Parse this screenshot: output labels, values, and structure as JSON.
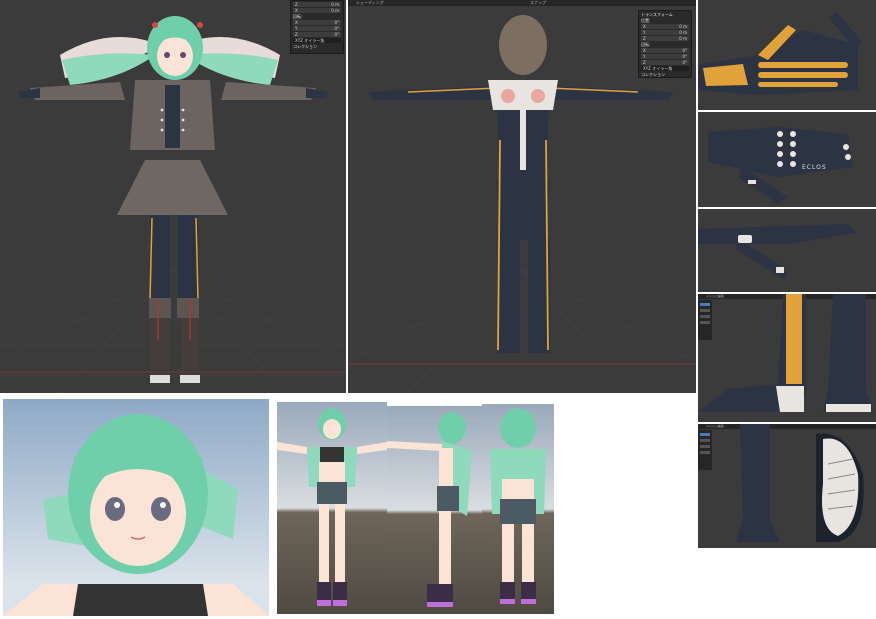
{
  "panels": {
    "front_view": {
      "npanel": {
        "rows_top": [
          {
            "label": "Z",
            "value": "0 m"
          },
          {
            "label": "X",
            "value": "0 m"
          }
        ],
        "section_label": "回転:",
        "rows_mid": [
          {
            "label": "X",
            "value": "0°"
          },
          {
            "label": "Y",
            "value": "0°"
          },
          {
            "label": "Z",
            "value": "0°"
          }
        ],
        "mode": "XYZ オイラー角",
        "collection": "コレクション"
      }
    },
    "back_view": {
      "header_title": "シェーディング",
      "header_right": "スナップ",
      "npanel": {
        "title": "トランスフォーム",
        "section1": "位置:",
        "rows1": [
          {
            "label": "X",
            "value": "0 m"
          },
          {
            "label": "Y",
            "value": "0 m"
          },
          {
            "label": "Z",
            "value": "0 m"
          }
        ],
        "section2": "回転:",
        "rows2": [
          {
            "label": "X",
            "value": "0°"
          },
          {
            "label": "Y",
            "value": "0°"
          },
          {
            "label": "Z",
            "value": "0°"
          }
        ],
        "mode": "XYZ オイラー角",
        "collection": "コレクション"
      }
    },
    "hand_glove": {
      "logo_text": "ECLOS"
    },
    "foot_side": {
      "header_title": "メッシュ編集"
    },
    "foot_sole": {
      "header_title": "メッシュ編集"
    }
  },
  "colors": {
    "viewport_bg": "#3b3b3b",
    "hair": "#6fcfaa",
    "suit": "#2c3342",
    "accent_stripe": "#e2a23a",
    "wing": "#8fd9bd"
  }
}
